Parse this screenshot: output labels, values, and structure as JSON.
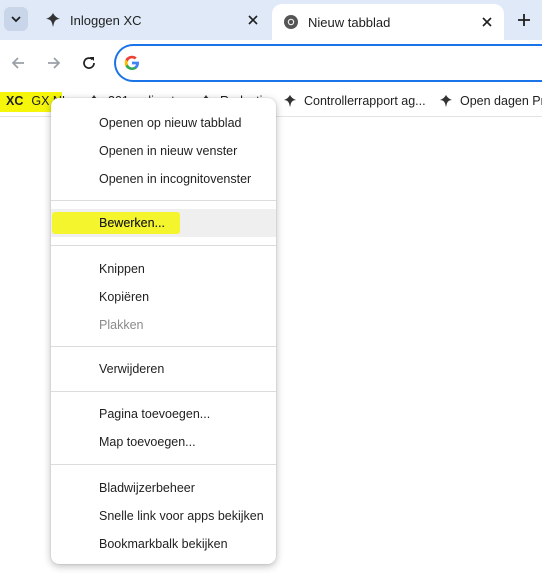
{
  "tabs": [
    {
      "title": "Inloggen XC",
      "icon": "spa-logo-icon",
      "active": false
    },
    {
      "title": "Nieuw tabblad",
      "icon": "chrome-icon",
      "active": true
    }
  ],
  "toolbar": {
    "address_value": "",
    "address_icon": "google-g-icon"
  },
  "bookmarks": [
    {
      "label_bold": "XC",
      "label": "GX NL"
    },
    {
      "label": "301-redirects",
      "icon": "spa-logo-icon"
    },
    {
      "label": "Redactie",
      "icon": "spa-logo-icon"
    },
    {
      "label": "Controllerrapport ag...",
      "icon": "spa-logo-icon"
    },
    {
      "label": "Open dagen Pro",
      "icon": "spa-logo-icon"
    }
  ],
  "context_menu": {
    "items": [
      {
        "label": "Openen op nieuw tabblad",
        "enabled": true
      },
      {
        "label": "Openen in nieuw venster",
        "enabled": true
      },
      {
        "label": "Openen in incognitovenster",
        "enabled": true
      },
      {
        "label": "Bewerken...",
        "enabled": true,
        "highlighted": true
      },
      {
        "label": "Knippen",
        "enabled": true
      },
      {
        "label": "Kopiëren",
        "enabled": true
      },
      {
        "label": "Plakken",
        "enabled": false
      },
      {
        "label": "Verwijderen",
        "enabled": true
      },
      {
        "label": "Pagina toevoegen...",
        "enabled": true
      },
      {
        "label": "Map toevoegen...",
        "enabled": true
      },
      {
        "label": "Bladwijzerbeheer",
        "enabled": true
      },
      {
        "label": "Snelle link voor apps bekijken",
        "enabled": true
      },
      {
        "label": "Bookmarkbalk bekijken",
        "enabled": true
      }
    ]
  },
  "colors": {
    "tabstrip_bg": "#dfe9f8",
    "omnibox_border": "#1a73e8",
    "highlight": "#f5f60a"
  }
}
